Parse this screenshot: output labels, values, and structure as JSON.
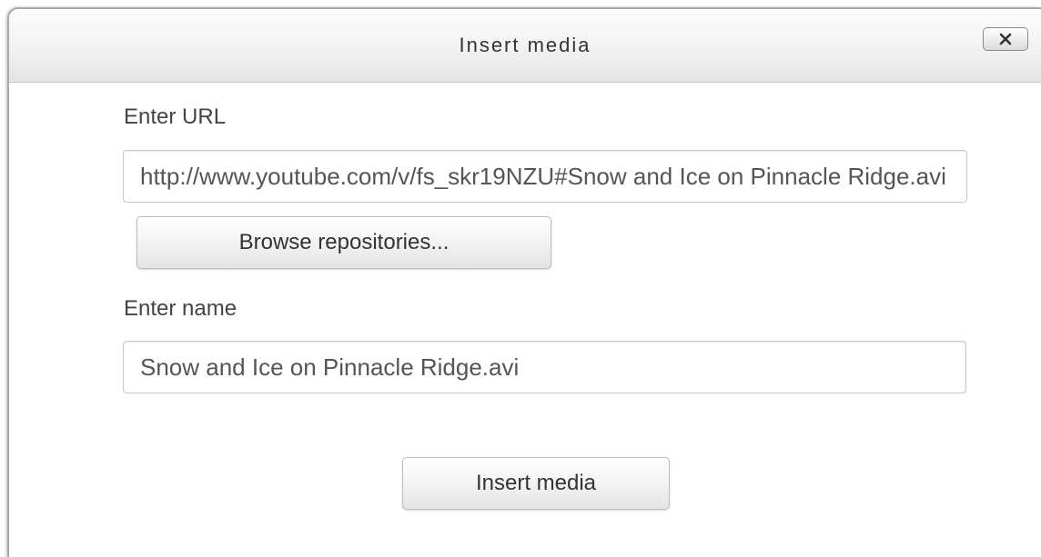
{
  "dialog": {
    "title": "Insert media",
    "close_icon": "close-x-icon"
  },
  "url_section": {
    "label": "Enter URL",
    "value": "http://www.youtube.com/v/fs_skr19NZU#Snow and Ice on Pinnacle Ridge.avi",
    "browse_button_label": "Browse repositories..."
  },
  "name_section": {
    "label": "Enter name",
    "value": "Snow and Ice on Pinnacle Ridge.avi"
  },
  "footer": {
    "submit_label": "Insert media"
  }
}
